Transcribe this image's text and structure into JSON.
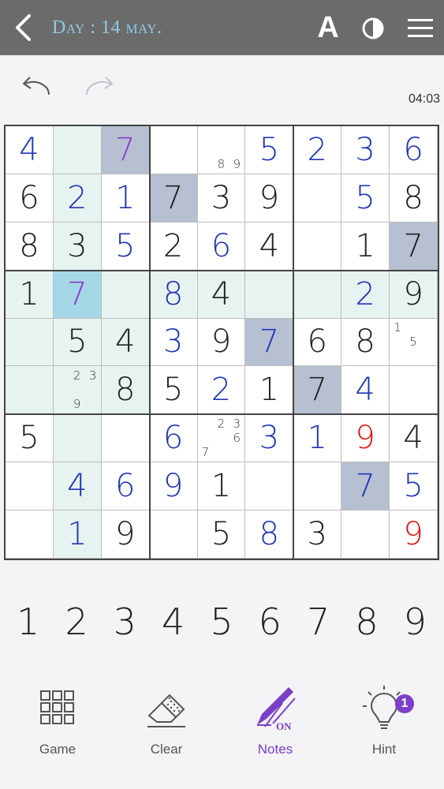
{
  "header": {
    "title": "Day : 14 may.",
    "font_button_label": "A",
    "back_icon": "chevron-left-icon",
    "contrast_icon": "contrast-icon",
    "menu_icon": "hamburger-menu-icon",
    "bg_color": "#6b6b6b",
    "title_color": "#8fcbe3"
  },
  "controls": {
    "undo_icon": "undo-icon",
    "redo_icon": "redo-icon",
    "timer": "04:03"
  },
  "board": {
    "colors": {
      "given": "#222222",
      "user": "#2336b8",
      "error": "#e0151b",
      "selected_value": "#8d39d4",
      "highlight_light": "#e6f3f0",
      "highlight_gray": "#b6c0d0",
      "selected_cell": "#a5d8e6"
    },
    "rows": [
      [
        {
          "v": "4",
          "t": "user"
        },
        {
          "v": "",
          "bg": "light"
        },
        {
          "v": "7",
          "t": "purple",
          "bg": "gray"
        },
        {
          "v": ""
        },
        {
          "v": "",
          "notes": [
            "",
            "",
            "",
            "",
            "",
            "",
            "",
            "8",
            "9"
          ]
        },
        {
          "v": "5",
          "t": "user"
        },
        {
          "v": "2",
          "t": "user"
        },
        {
          "v": "3",
          "t": "user"
        },
        {
          "v": "6",
          "t": "user"
        }
      ],
      [
        {
          "v": "6",
          "t": "given"
        },
        {
          "v": "2",
          "t": "user",
          "bg": "light"
        },
        {
          "v": "1",
          "t": "user"
        },
        {
          "v": "7",
          "t": "given",
          "bg": "gray"
        },
        {
          "v": "3",
          "t": "given"
        },
        {
          "v": "9",
          "t": "given"
        },
        {
          "v": ""
        },
        {
          "v": "5",
          "t": "user"
        },
        {
          "v": "8",
          "t": "given"
        }
      ],
      [
        {
          "v": "8",
          "t": "given"
        },
        {
          "v": "3",
          "t": "given",
          "bg": "light"
        },
        {
          "v": "5",
          "t": "user"
        },
        {
          "v": "2",
          "t": "given"
        },
        {
          "v": "6",
          "t": "user"
        },
        {
          "v": "4",
          "t": "given"
        },
        {
          "v": ""
        },
        {
          "v": "1",
          "t": "given"
        },
        {
          "v": "7",
          "t": "given",
          "bg": "gray"
        }
      ],
      [
        {
          "v": "1",
          "t": "given",
          "bg": "light"
        },
        {
          "v": "7",
          "t": "purple",
          "bg": "sel"
        },
        {
          "v": "",
          "bg": "light"
        },
        {
          "v": "8",
          "t": "user",
          "bg": "light"
        },
        {
          "v": "4",
          "t": "given",
          "bg": "light"
        },
        {
          "v": "",
          "bg": "light"
        },
        {
          "v": "",
          "bg": "light"
        },
        {
          "v": "2",
          "t": "user",
          "bg": "light"
        },
        {
          "v": "9",
          "t": "given",
          "bg": "light"
        }
      ],
      [
        {
          "v": "",
          "bg": "light"
        },
        {
          "v": "5",
          "t": "given",
          "bg": "light"
        },
        {
          "v": "4",
          "t": "given",
          "bg": "light"
        },
        {
          "v": "3",
          "t": "user"
        },
        {
          "v": "9",
          "t": "given"
        },
        {
          "v": "7",
          "t": "user",
          "bg": "gray"
        },
        {
          "v": "6",
          "t": "given"
        },
        {
          "v": "8",
          "t": "given"
        },
        {
          "v": "",
          "notes": [
            "1",
            "",
            "",
            "",
            "5",
            "",
            "",
            "",
            ""
          ]
        }
      ],
      [
        {
          "v": "",
          "bg": "light"
        },
        {
          "v": "",
          "bg": "light",
          "notes": [
            "",
            "2",
            "3",
            "",
            "",
            "",
            "",
            "9",
            ""
          ]
        },
        {
          "v": "8",
          "t": "given",
          "bg": "light"
        },
        {
          "v": "5",
          "t": "given"
        },
        {
          "v": "2",
          "t": "user"
        },
        {
          "v": "1",
          "t": "given"
        },
        {
          "v": "7",
          "t": "given",
          "bg": "gray"
        },
        {
          "v": "4",
          "t": "user"
        },
        {
          "v": ""
        }
      ],
      [
        {
          "v": "5",
          "t": "given"
        },
        {
          "v": "",
          "bg": "light"
        },
        {
          "v": ""
        },
        {
          "v": "6",
          "t": "user"
        },
        {
          "v": "",
          "notes": [
            "",
            "2",
            "3",
            "",
            "",
            "6",
            "7",
            "",
            ""
          ]
        },
        {
          "v": "3",
          "t": "user"
        },
        {
          "v": "1",
          "t": "user"
        },
        {
          "v": "9",
          "t": "error"
        },
        {
          "v": "4",
          "t": "given"
        }
      ],
      [
        {
          "v": ""
        },
        {
          "v": "4",
          "t": "user",
          "bg": "light"
        },
        {
          "v": "6",
          "t": "user"
        },
        {
          "v": "9",
          "t": "user"
        },
        {
          "v": "1",
          "t": "given"
        },
        {
          "v": ""
        },
        {
          "v": ""
        },
        {
          "v": "7",
          "t": "user",
          "bg": "gray"
        },
        {
          "v": "5",
          "t": "user"
        }
      ],
      [
        {
          "v": ""
        },
        {
          "v": "1",
          "t": "user",
          "bg": "light"
        },
        {
          "v": "9",
          "t": "given"
        },
        {
          "v": ""
        },
        {
          "v": "5",
          "t": "given"
        },
        {
          "v": "8",
          "t": "user"
        },
        {
          "v": "3",
          "t": "given"
        },
        {
          "v": ""
        },
        {
          "v": "9",
          "t": "error"
        }
      ]
    ]
  },
  "numpad": [
    "1",
    "2",
    "3",
    "4",
    "5",
    "6",
    "7",
    "8",
    "9"
  ],
  "toolbar": {
    "game_label": "Game",
    "clear_label": "Clear",
    "notes_label": "Notes",
    "notes_state": "ON",
    "hint_label": "Hint",
    "hint_count": "1",
    "game_icon": "grid-icon",
    "clear_icon": "eraser-icon",
    "notes_icon": "pencil-icon",
    "hint_icon": "lightbulb-icon",
    "active_color": "#7a3fc8"
  }
}
